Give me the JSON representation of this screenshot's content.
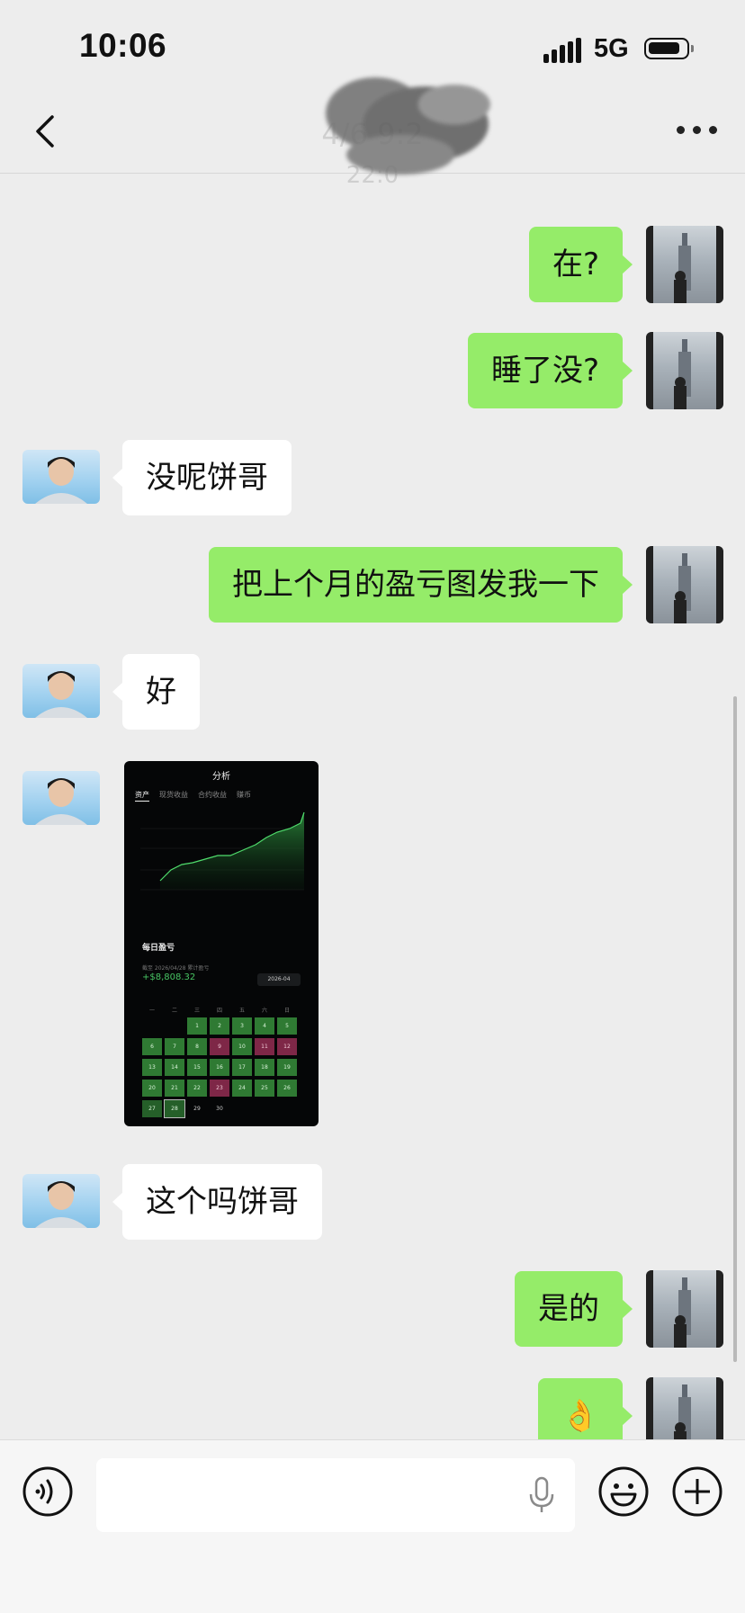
{
  "status_bar": {
    "time": "10:06",
    "network": "5G"
  },
  "nav": {
    "title": "4/6 9:2",
    "subtitle": "22:0"
  },
  "messages": [
    {
      "side": "me",
      "text": "在?"
    },
    {
      "side": "me",
      "text": "睡了没?"
    },
    {
      "side": "other",
      "text": "没呢饼哥"
    },
    {
      "side": "me",
      "text": "把上个月的盈亏图发我一下"
    },
    {
      "side": "other",
      "text": "好"
    },
    {
      "side": "other",
      "type": "image"
    },
    {
      "side": "other",
      "text": "这个吗饼哥"
    },
    {
      "side": "me",
      "text": "是的"
    },
    {
      "side": "me",
      "text": "👌"
    }
  ],
  "shared_image": {
    "header_title": "分析",
    "tabs": [
      "资产",
      "现货收益",
      "合约收益",
      "赚币"
    ],
    "pnl_title": "每日盈亏",
    "pnl_subtitle": "截至 2026/04/28 累计盈亏",
    "pnl_value": "+$8,808.32",
    "month": "2026-04",
    "weekdays": [
      "一",
      "二",
      "三",
      "四",
      "五",
      "六",
      "日"
    ]
  },
  "colors": {
    "bubble_me": "#95ec69",
    "bubble_other": "#ffffff",
    "background": "#ededed"
  },
  "icons": {
    "back": "chevron-left-icon",
    "more": "more-dots-icon",
    "voice": "voice-icon",
    "mic": "microphone-icon",
    "emoji": "emoji-icon",
    "plus": "plus-icon"
  }
}
